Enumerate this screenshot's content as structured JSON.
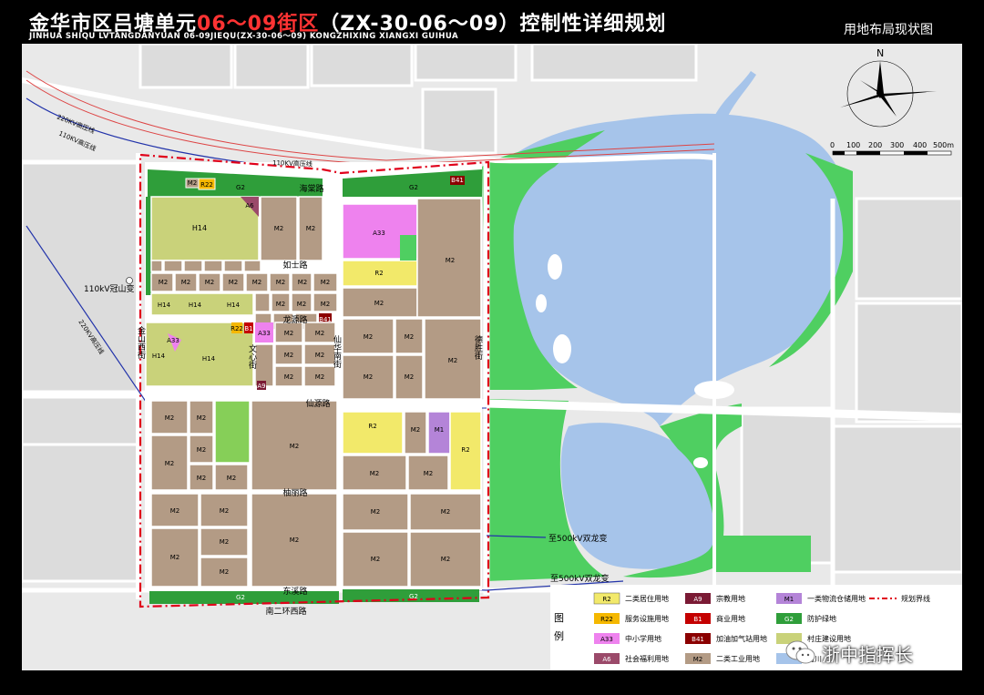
{
  "header": {
    "title_part1": "金华市区吕塘单元",
    "title_part2": "06～09街区",
    "title_part3": "（ZX-30-06～09）控制性详细规划",
    "subtitle": "JINHUA  SHIQU LVTANGDANYUAN 06-09JIEQU(ZX-30-06～09) KONGZHIXING XIANGXI GUIHUA",
    "map_name": "用地布局现状图"
  },
  "compass": {
    "north": "N"
  },
  "scale_bar": {
    "ticks": [
      "0",
      "100",
      "200",
      "300",
      "400",
      "500m"
    ]
  },
  "roads": {
    "haiyan": "海棠路",
    "rushi": "如士路",
    "longlin": "龙源路",
    "xianyuan": "仙源路",
    "youxi": "柚丽路",
    "south": "东溪路",
    "ring": "南二环西路",
    "west_street": "金山西街",
    "mid_street1": "文心街",
    "mid_street2": "仙华南街",
    "east_street": "德胜街"
  },
  "power_lines": {
    "l1": "220KV高压线",
    "l2": "110KV高压线",
    "l3": "110KV高压线",
    "l4": "220KV高压线"
  },
  "annotations": {
    "substation": "110kV冠山变",
    "to_500_1": "至500kV双龙变",
    "to_500_2": "至500kV双龙变"
  },
  "colors": {
    "boundary": "#e0001a",
    "water": "#a6c4ea",
    "green": "#4fcf61",
    "industrial": "#b39b85",
    "village": "#c9d27a",
    "roads": "#ffffff",
    "bg": "#e9e9e9"
  },
  "parcel_codes": {
    "R2": "R2",
    "R22": "R22",
    "A33": "A33",
    "A6": "A6",
    "A9": "A9",
    "B1": "B1",
    "B41": "B41",
    "M1": "M1",
    "M2": "M2",
    "G2": "G2",
    "H14": "H14"
  },
  "legend": {
    "title_tu": "图",
    "title_li": "例",
    "items": [
      {
        "code": "R2",
        "label": "二类居住用地",
        "color": "#f2e96a"
      },
      {
        "code": "A9",
        "label": "宗教用地",
        "color": "#7a1a34"
      },
      {
        "code": "M1",
        "label": "一类物流仓储用地",
        "color": "#b484d8"
      },
      {
        "code": "",
        "label": "规划界线",
        "color": "#e0001a"
      },
      {
        "code": "R22",
        "label": "服务设施用地",
        "color": "#f5b800"
      },
      {
        "code": "B1",
        "label": "商业用地",
        "color": "#c40000"
      },
      {
        "code": "G2",
        "label": "防护绿地",
        "color": "#2f9e3a"
      },
      {
        "code": "A33",
        "label": "中小学用地",
        "color": "#ee82ee"
      },
      {
        "code": "B41",
        "label": "加油加气站用地",
        "color": "#8b0000"
      },
      {
        "code": "",
        "label": "村庄建设用地",
        "color": "#c9d27a"
      },
      {
        "code": "A6",
        "label": "社会福利用地",
        "color": "#9b4a6a"
      },
      {
        "code": "M2",
        "label": "二类工业用地",
        "color": "#b39b85"
      },
      {
        "code": "",
        "label": "河川",
        "color": "#a6c4ea"
      }
    ]
  },
  "watermark": {
    "text": "浙中指挥长"
  }
}
